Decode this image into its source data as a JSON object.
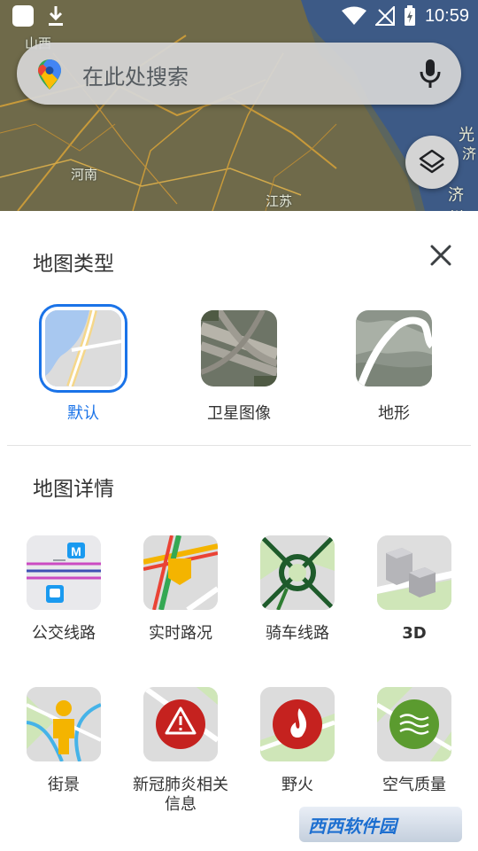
{
  "status_bar": {
    "time": "10:59"
  },
  "search": {
    "placeholder": "在此处搜索"
  },
  "map_labels": [
    "山西",
    "河南",
    "江苏",
    "光",
    "济州",
    "济"
  ],
  "map_type": {
    "title": "地图类型",
    "options": [
      {
        "label": "默认",
        "selected": true
      },
      {
        "label": "卫星图像",
        "selected": false
      },
      {
        "label": "地形",
        "selected": false
      }
    ]
  },
  "map_details": {
    "title": "地图详情",
    "options": [
      {
        "label": "公交线路",
        "icon": "transit-icon"
      },
      {
        "label": "实时路况",
        "icon": "traffic-icon"
      },
      {
        "label": "骑车线路",
        "icon": "bike-icon"
      },
      {
        "label": "3D",
        "icon": "3d-buildings-icon"
      },
      {
        "label": "街景",
        "icon": "street-view-icon"
      },
      {
        "label": "新冠肺炎相关\n信息",
        "icon": "covid-info-icon"
      },
      {
        "label": "野火",
        "icon": "wildfire-icon"
      },
      {
        "label": "空气质量",
        "icon": "air-quality-icon"
      }
    ]
  },
  "watermark": {
    "text": "西西软件园"
  },
  "colors": {
    "accent": "#1a73e8",
    "sheet_bg": "#ffffff",
    "map_bg": "#59636a"
  }
}
